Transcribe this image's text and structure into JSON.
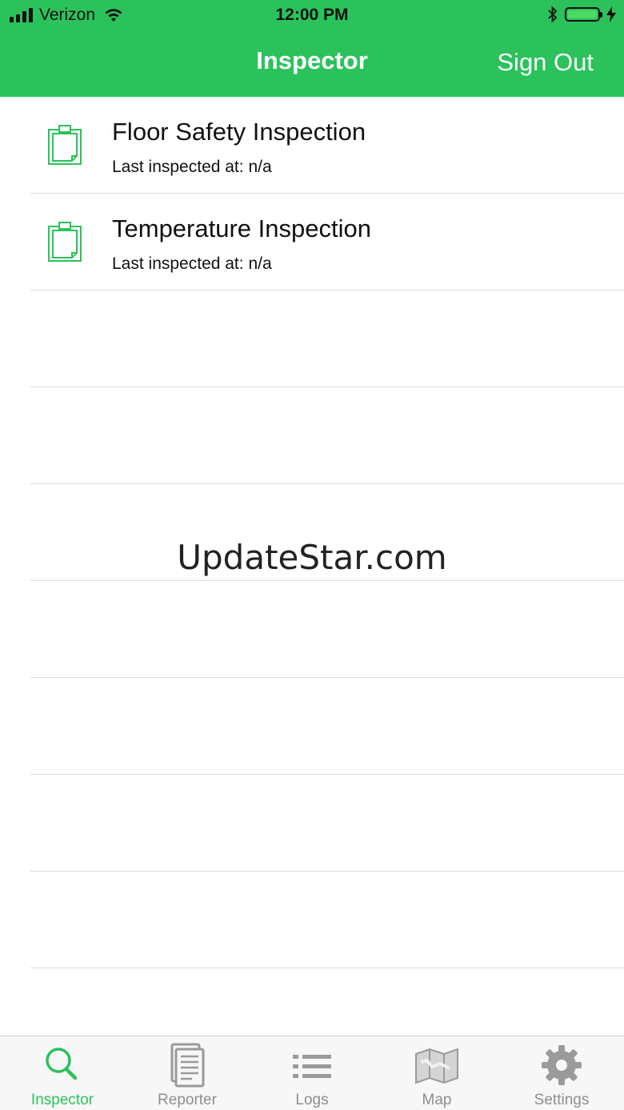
{
  "status_bar": {
    "carrier": "Verizon",
    "time": "12:00 PM",
    "battery_level": 1.0
  },
  "nav": {
    "title": "Inspector",
    "sign_out_label": "Sign Out"
  },
  "inspections": [
    {
      "title": "Floor Safety Inspection",
      "subtitle": "Last inspected at: n/a",
      "icon": "clipboard-icon"
    },
    {
      "title": "Temperature Inspection",
      "subtitle": "Last inspected at: n/a",
      "icon": "clipboard-icon"
    }
  ],
  "watermark": "UpdateStar.com",
  "tabs": [
    {
      "label": "Inspector",
      "icon": "search-icon",
      "active": true
    },
    {
      "label": "Reporter",
      "icon": "document-icon",
      "active": false
    },
    {
      "label": "Logs",
      "icon": "list-icon",
      "active": false
    },
    {
      "label": "Map",
      "icon": "map-icon",
      "active": false
    },
    {
      "label": "Settings",
      "icon": "gear-icon",
      "active": false
    }
  ],
  "colors": {
    "accent": "#2bc25c",
    "inactive": "#8e8e8e",
    "separator": "#dcdcdc"
  }
}
